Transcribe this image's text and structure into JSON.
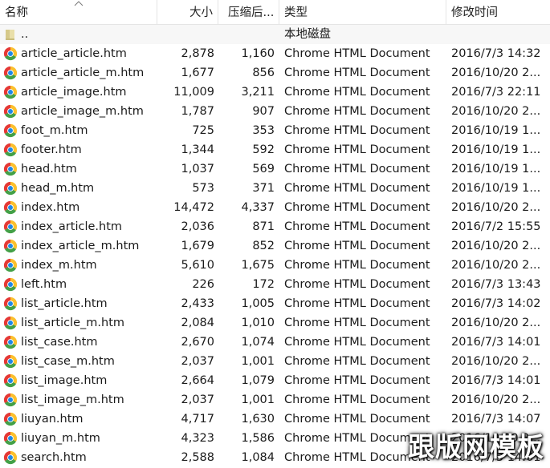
{
  "columns": {
    "name": "名称",
    "size": "大小",
    "compressed": "压缩后...",
    "type": "类型",
    "modified": "修改时间"
  },
  "parent_row": {
    "name": "..",
    "type": "本地磁盘"
  },
  "files": [
    {
      "name": "article_article.htm",
      "size": "2,878",
      "compressed": "1,160",
      "type": "Chrome HTML Document",
      "modified": "2016/7/3 14:32"
    },
    {
      "name": "article_article_m.htm",
      "size": "1,677",
      "compressed": "856",
      "type": "Chrome HTML Document",
      "modified": "2016/10/20 2..."
    },
    {
      "name": "article_image.htm",
      "size": "11,009",
      "compressed": "3,211",
      "type": "Chrome HTML Document",
      "modified": "2016/7/3 22:11"
    },
    {
      "name": "article_image_m.htm",
      "size": "1,787",
      "compressed": "907",
      "type": "Chrome HTML Document",
      "modified": "2016/10/20 2..."
    },
    {
      "name": "foot_m.htm",
      "size": "725",
      "compressed": "353",
      "type": "Chrome HTML Document",
      "modified": "2016/10/19 1..."
    },
    {
      "name": "footer.htm",
      "size": "1,344",
      "compressed": "592",
      "type": "Chrome HTML Document",
      "modified": "2016/10/19 1..."
    },
    {
      "name": "head.htm",
      "size": "1,037",
      "compressed": "569",
      "type": "Chrome HTML Document",
      "modified": "2016/10/19 1..."
    },
    {
      "name": "head_m.htm",
      "size": "573",
      "compressed": "371",
      "type": "Chrome HTML Document",
      "modified": "2016/10/19 1..."
    },
    {
      "name": "index.htm",
      "size": "14,472",
      "compressed": "4,337",
      "type": "Chrome HTML Document",
      "modified": "2016/10/20 2..."
    },
    {
      "name": "index_article.htm",
      "size": "2,036",
      "compressed": "871",
      "type": "Chrome HTML Document",
      "modified": "2016/7/2 15:55"
    },
    {
      "name": "index_article_m.htm",
      "size": "1,679",
      "compressed": "852",
      "type": "Chrome HTML Document",
      "modified": "2016/10/20 2..."
    },
    {
      "name": "index_m.htm",
      "size": "5,610",
      "compressed": "1,675",
      "type": "Chrome HTML Document",
      "modified": "2016/10/20 2..."
    },
    {
      "name": "left.htm",
      "size": "226",
      "compressed": "172",
      "type": "Chrome HTML Document",
      "modified": "2016/7/3 13:43"
    },
    {
      "name": "list_article.htm",
      "size": "2,433",
      "compressed": "1,005",
      "type": "Chrome HTML Document",
      "modified": "2016/7/3 14:02"
    },
    {
      "name": "list_article_m.htm",
      "size": "2,084",
      "compressed": "1,010",
      "type": "Chrome HTML Document",
      "modified": "2016/10/20 2..."
    },
    {
      "name": "list_case.htm",
      "size": "2,670",
      "compressed": "1,074",
      "type": "Chrome HTML Document",
      "modified": "2016/7/3 14:01"
    },
    {
      "name": "list_case_m.htm",
      "size": "2,037",
      "compressed": "1,001",
      "type": "Chrome HTML Document",
      "modified": "2016/10/20 2..."
    },
    {
      "name": "list_image.htm",
      "size": "2,664",
      "compressed": "1,079",
      "type": "Chrome HTML Document",
      "modified": "2016/7/3 14:01"
    },
    {
      "name": "list_image_m.htm",
      "size": "2,037",
      "compressed": "1,001",
      "type": "Chrome HTML Document",
      "modified": "2016/10/20 2..."
    },
    {
      "name": "liuyan.htm",
      "size": "4,717",
      "compressed": "1,630",
      "type": "Chrome HTML Document",
      "modified": "2016/7/3 14:07"
    },
    {
      "name": "liuyan_m.htm",
      "size": "4,323",
      "compressed": "1,586",
      "type": "Chrome HTML Document",
      "modified": "2016/10/20 2..."
    },
    {
      "name": "search.htm",
      "size": "2,588",
      "compressed": "1,084",
      "type": "Chrome HTML Document",
      "modified": "2016/7/3 14:01"
    }
  ],
  "icons": {
    "file": "chrome-icon",
    "parent": "folder-icon"
  },
  "watermark": "跟版网模板"
}
